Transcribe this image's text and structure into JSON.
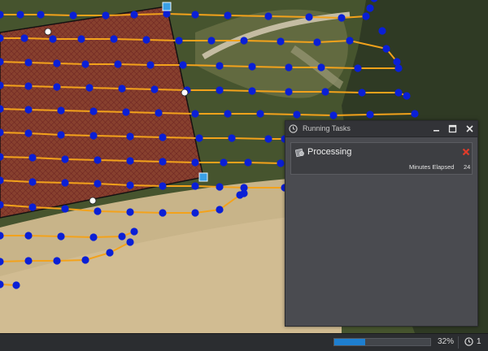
{
  "running_tasks": {
    "title": "Running Tasks",
    "tasks": [
      {
        "name": "Processing",
        "elapsed_label": "Minutes Elapsed",
        "elapsed_value": "24"
      }
    ]
  },
  "status_bar": {
    "progress_percent": 32,
    "progress_text": "32%",
    "task_count": "1"
  },
  "icons": {
    "clock": "clock-icon",
    "minimize": "minimize-icon",
    "maximize": "maximize-icon",
    "close": "close-icon",
    "task": "task-gear-icon",
    "cancel": "cancel-x-icon"
  },
  "colors": {
    "flight_line": "#f3a21b",
    "waypoint": "#0a1fd6",
    "polygon_fill": "#b0332f",
    "progress_fill": "#1e7fd0",
    "cancel": "#e03b2a"
  }
}
